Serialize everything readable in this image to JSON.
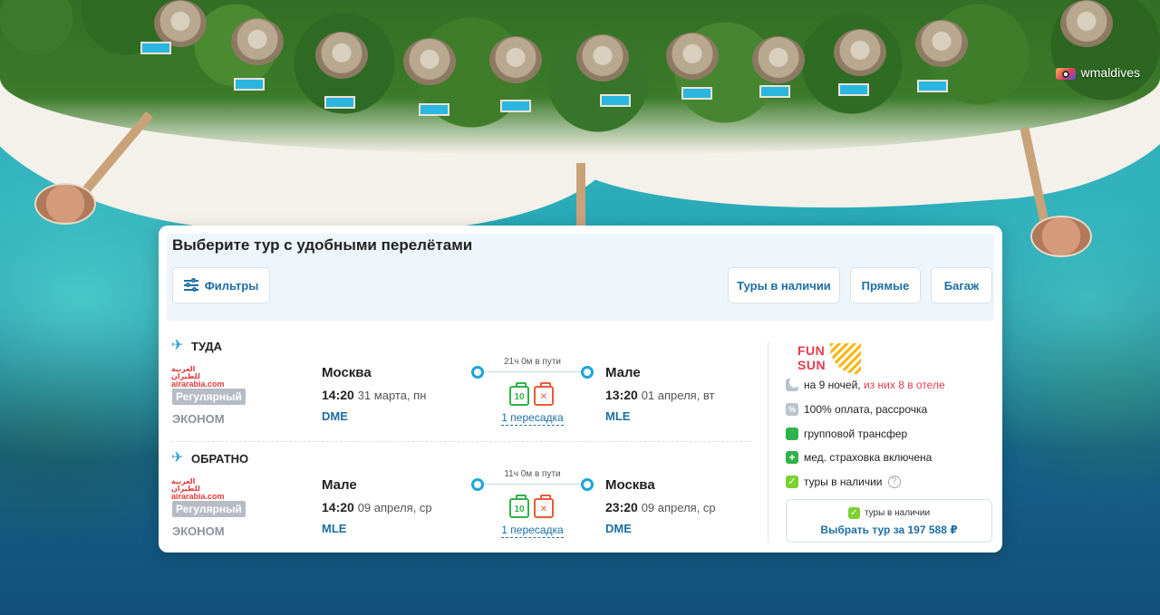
{
  "watermark": {
    "text": "wmaldives",
    "icon": "camera-icon"
  },
  "card": {
    "title": "Выберите тур с удобными перелётами",
    "filters_label": "Фильтры",
    "chips": [
      "Туры в наличии",
      "Прямые",
      "Багаж"
    ]
  },
  "flights": {
    "outbound": {
      "label": "ТУДА",
      "airline_ar": "العربية للطيران",
      "airline_en": "airarabia.com",
      "fare_type": "Регулярный",
      "cabin": "ЭКОНОМ",
      "dep_city": "Москва",
      "dep_time": "14:20",
      "dep_date": "31 марта, пн",
      "dep_code": "DME",
      "duration": "21ч 0м в пути",
      "transfers": "1 пересадка",
      "carry_on": "10",
      "arr_city": "Мале",
      "arr_time": "13:20",
      "arr_date": "01 апреля, вт",
      "arr_code": "MLE"
    },
    "return": {
      "label": "ОБРАТНО",
      "airline_ar": "العربية للطيران",
      "airline_en": "airarabia.com",
      "fare_type": "Регулярный",
      "cabin": "ЭКОНОМ",
      "dep_city": "Мале",
      "dep_time": "14:20",
      "dep_date": "09 апреля, ср",
      "dep_code": "MLE",
      "duration": "11ч 0м в пути",
      "transfers": "1 пересадка",
      "carry_on": "10",
      "arr_city": "Москва",
      "arr_time": "23:20",
      "arr_date": "09 апреля, ср",
      "arr_code": "DME"
    }
  },
  "tour": {
    "operator_line1": "FUN",
    "operator_line2": "&",
    "operator_line3": "SUN",
    "nights_prefix": "на 9 ночей, ",
    "nights_hotel": "из них 8 в отеле",
    "payment": "100% оплата, рассрочка",
    "transfer": "групповой трансфер",
    "insurance": "мед. страховка включена",
    "availability": "туры в наличии",
    "help": "?",
    "buy_availability": "туры в наличии",
    "buy_label": "Выбрать тур за 197 588 ₽"
  },
  "colors": {
    "accent": "#1d6fa5",
    "plane": "#2aa3d6",
    "highlight_red": "#e8394d",
    "green": "#2fb34a"
  }
}
